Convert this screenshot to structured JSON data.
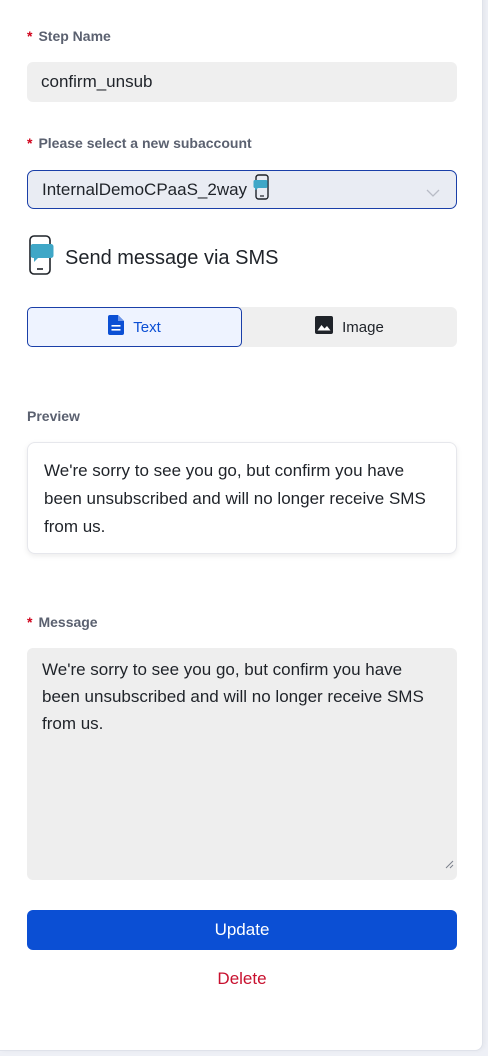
{
  "step_name": {
    "label": "Step Name",
    "value": "confirm_unsub"
  },
  "subaccount": {
    "label": "Please select a new subaccount",
    "value": "InternalDemoCPaaS_2way",
    "icon": "phone-chat-icon"
  },
  "channel": {
    "label": "Send message via SMS",
    "icon": "phone-chat-icon"
  },
  "tabs": [
    {
      "label": "Text",
      "icon": "document-icon",
      "active": true
    },
    {
      "label": "Image",
      "icon": "image-icon",
      "active": false
    }
  ],
  "preview": {
    "label": "Preview",
    "text": "We're sorry to see you go, but confirm you have been unsubscribed and will no longer receive SMS from us."
  },
  "message": {
    "label": "Message",
    "value": "We're sorry to see you go, but confirm you have been unsubscribed and will no longer receive SMS from us."
  },
  "actions": {
    "update": "Update",
    "delete": "Delete"
  },
  "required_marker": "*",
  "colors": {
    "primary": "#0b4fd4",
    "danger": "#c8102e",
    "required": "#d0021b",
    "field_bg": "#efefef"
  }
}
